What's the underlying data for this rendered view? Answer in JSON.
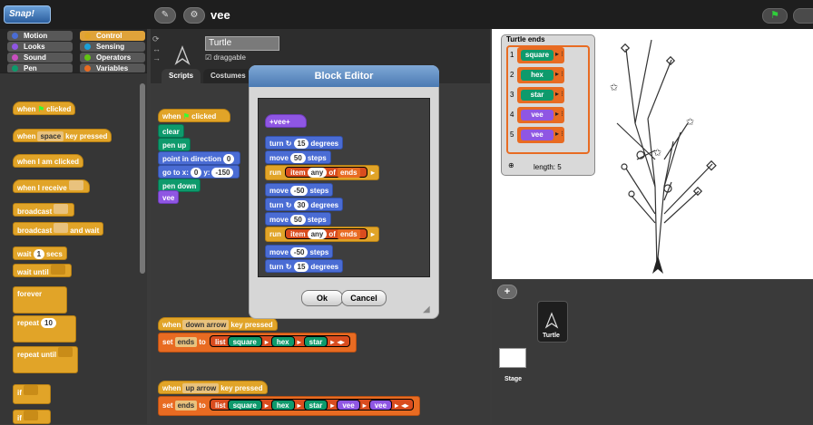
{
  "top": {
    "logo": "Snap!",
    "project_name": "vee",
    "flag": "⚑"
  },
  "categories": [
    {
      "label": "Motion",
      "color": "#4a6cd4",
      "selected": false
    },
    {
      "label": "Control",
      "color": "#e1a428",
      "selected": true
    },
    {
      "label": "Looks",
      "color": "#8f56e3",
      "selected": false
    },
    {
      "label": "Sensing",
      "color": "#1aa0d8",
      "selected": false
    },
    {
      "label": "Sound",
      "color": "#c94fbf",
      "selected": false
    },
    {
      "label": "Operators",
      "color": "#62c213",
      "selected": false
    },
    {
      "label": "Pen",
      "color": "#0e9a6c",
      "selected": false
    },
    {
      "label": "Variables",
      "color": "#e86b22",
      "selected": false
    }
  ],
  "palette": {
    "when_clicked": "when",
    "when_clicked2": "clicked",
    "when_key": "when",
    "when_key_slot": "space",
    "when_key2": "key pressed",
    "when_clicked_i": "when I am clicked",
    "when_receive": "when I receive",
    "broadcast": "broadcast",
    "broadcast_wait": "and wait",
    "wait": "wait",
    "wait_val": "1",
    "wait_secs": "secs",
    "wait_until": "wait until",
    "forever": "forever",
    "repeat": "repeat",
    "repeat_val": "10",
    "repeat_until": "repeat until",
    "if": "if",
    "if2": "if"
  },
  "sprite": {
    "name": "Turtle",
    "draggable": "draggable",
    "tabs": [
      "Scripts",
      "Costumes"
    ]
  },
  "script1": {
    "hat": "when",
    "hat2": "clicked",
    "clear": "clear",
    "pen_up": "pen up",
    "point": "point in direction",
    "point_val": "0",
    "goto": "go to x:",
    "x": "0",
    "y_label": "y:",
    "y": "-150",
    "pen_down": "pen down",
    "vee": "vee"
  },
  "script2": {
    "hat": "when",
    "key": "down arrow",
    "hat2": "key pressed",
    "set": "set",
    "var": "ends",
    "to": "to",
    "list": "list",
    "items": [
      "square",
      "hex",
      "star"
    ]
  },
  "script3": {
    "hat": "when",
    "key": "up arrow",
    "hat2": "key pressed",
    "set": "set",
    "var": "ends",
    "to": "to",
    "list": "list",
    "items": [
      "square",
      "hex",
      "star",
      "vee",
      "vee"
    ]
  },
  "dialog": {
    "title": "Block Editor",
    "proto": "vee",
    "turn": "turn",
    "deg": "degrees",
    "move": "move",
    "steps": "steps",
    "run": "run",
    "item": "item",
    "any": "any",
    "of": "of",
    "ends": "ends",
    "t1": "15",
    "m1": "50",
    "m2": "-50",
    "t2": "30",
    "m3": "50",
    "m4": "-50",
    "t3": "15",
    "ok": "Ok",
    "cancel": "Cancel"
  },
  "stage": {
    "watcher_title": "Turtle ends",
    "rows": [
      {
        "i": "1",
        "v": "square",
        "color": "#0e9a6c"
      },
      {
        "i": "2",
        "v": "hex",
        "color": "#0e9a6c"
      },
      {
        "i": "3",
        "v": "star",
        "color": "#0e9a6c"
      },
      {
        "i": "4",
        "v": "vee",
        "color": "#8f56e3"
      },
      {
        "i": "5",
        "v": "vee",
        "color": "#8f56e3"
      }
    ],
    "length": "length: 5"
  },
  "corral": {
    "add": "+",
    "turtle": "Turtle",
    "stage": "Stage"
  }
}
